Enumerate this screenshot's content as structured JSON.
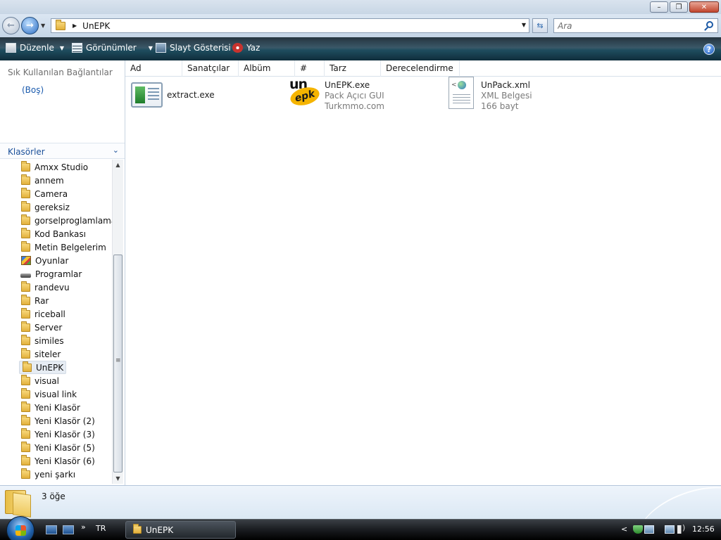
{
  "window": {
    "minimize_glyph": "–",
    "maximize_glyph": "❐",
    "close_glyph": "✕"
  },
  "address": {
    "crumb": "UnEPK",
    "search_placeholder": "Ara"
  },
  "toolbar": {
    "organize": "Düzenle",
    "views": "Görünümler",
    "slideshow": "Slayt Gösterisi",
    "print": "Yaz",
    "help": "?"
  },
  "left_pane": {
    "favorites_title": "Sık Kullanılan Bağlantılar",
    "favorites_empty": "(Boş)",
    "folders_title": "Klasörler",
    "folders": [
      {
        "label": "Amxx Studio",
        "icon": "folder"
      },
      {
        "label": "annem",
        "icon": "folder"
      },
      {
        "label": "Camera",
        "icon": "folder"
      },
      {
        "label": "gereksiz",
        "icon": "folder"
      },
      {
        "label": "gorselproglamlama",
        "icon": "folder"
      },
      {
        "label": "Kod Bankası",
        "icon": "folder"
      },
      {
        "label": "Metin Belgelerim",
        "icon": "folder"
      },
      {
        "label": "Oyunlar",
        "icon": "games"
      },
      {
        "label": "Programlar",
        "icon": "drive"
      },
      {
        "label": "randevu",
        "icon": "folder"
      },
      {
        "label": "Rar",
        "icon": "folder"
      },
      {
        "label": "riceball",
        "icon": "folder"
      },
      {
        "label": "Server",
        "icon": "folder"
      },
      {
        "label": "similes",
        "icon": "folder"
      },
      {
        "label": "siteler",
        "icon": "folder"
      },
      {
        "label": "UnEPK",
        "icon": "folder",
        "selected": true
      },
      {
        "label": "visual",
        "icon": "folder"
      },
      {
        "label": "visual link",
        "icon": "folder"
      },
      {
        "label": "Yeni Klasör",
        "icon": "folder"
      },
      {
        "label": "Yeni Klasör (2)",
        "icon": "folder"
      },
      {
        "label": "Yeni Klasör (3)",
        "icon": "folder"
      },
      {
        "label": "Yeni Klasör (5)",
        "icon": "folder"
      },
      {
        "label": "Yeni Klasör (6)",
        "icon": "folder"
      },
      {
        "label": "yeni şarkı",
        "icon": "folder"
      }
    ]
  },
  "columns": [
    "Ad",
    "Sanatçılar",
    "Albüm",
    "#",
    "Tarz",
    "Derecelendirme"
  ],
  "files": [
    {
      "name": "extract.exe",
      "line2": "",
      "line3": "",
      "icon": "exe-icon"
    },
    {
      "name": "UnEPK.exe",
      "line2": "Pack Açıcı GUI",
      "line3": "Turkmmo.com",
      "icon": "unepk-icon",
      "icon_text_top": "un",
      "icon_text_bottom": "epk"
    },
    {
      "name": "UnPack.xml",
      "line2": "XML Belgesi",
      "line3": "166 bayt",
      "icon": "xml-icon"
    }
  ],
  "details": {
    "count": "3 öğe"
  },
  "taskbar": {
    "quicklaunch_more": "»",
    "language": "TR",
    "window_button": "UnEPK",
    "tray_expand": "<",
    "clock": "12:56"
  },
  "colors": {
    "accent_link": "#1a5aad",
    "command_bar": "#1f4d5f",
    "taskbar": "#1c1f23"
  }
}
